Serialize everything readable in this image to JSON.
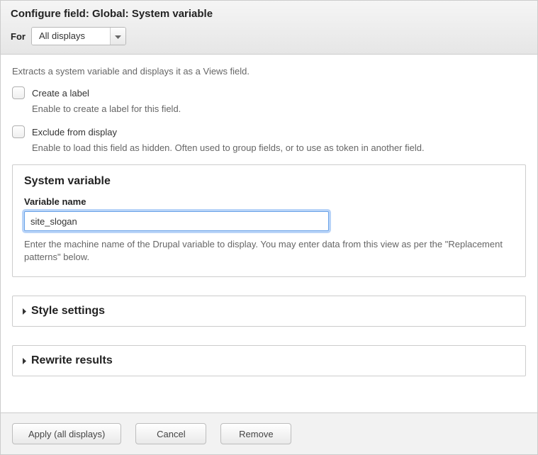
{
  "header": {
    "title": "Configure field: Global: System variable",
    "for_label": "For",
    "for_value": "All displays"
  },
  "top_description": "Extracts a system variable and displays it as a Views field.",
  "create_label": {
    "label": "Create a label",
    "desc": "Enable to create a label for this field."
  },
  "exclude": {
    "label": "Exclude from display",
    "desc": "Enable to load this field as hidden. Often used to group fields, or to use as token in another field."
  },
  "system_variable": {
    "title": "System variable",
    "field_label": "Variable name",
    "value": "site_slogan",
    "desc": "Enter the machine name of the Drupal variable to display. You may enter data from this view as per the \"Replacement patterns\" below."
  },
  "style_settings": {
    "title": "Style settings"
  },
  "rewrite_results": {
    "title": "Rewrite results"
  },
  "buttons": {
    "apply": "Apply (all displays)",
    "cancel": "Cancel",
    "remove": "Remove"
  }
}
